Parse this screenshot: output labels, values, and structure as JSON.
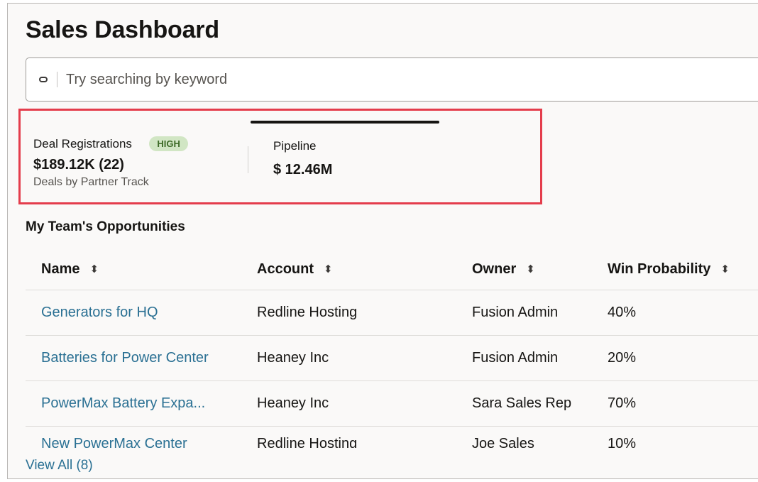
{
  "page": {
    "title": "Sales Dashboard"
  },
  "search": {
    "placeholder": "Try searching by keyword",
    "value": ""
  },
  "metrics": {
    "deal_registrations": {
      "label": "Deal Registrations",
      "badge": "HIGH",
      "value": "$189.12K (22)",
      "subtitle": "Deals by Partner Track"
    },
    "pipeline": {
      "label": "Pipeline",
      "value": "$ 12.46M"
    }
  },
  "opportunities": {
    "title": "My Team's Opportunities",
    "columns": [
      "Name",
      "Account",
      "Owner",
      "Win Probability"
    ],
    "rows": [
      {
        "name": "Generators for HQ",
        "account": "Redline Hosting",
        "owner": "Fusion Admin",
        "win_probability": "40%"
      },
      {
        "name": "Batteries for Power Center",
        "account": "Heaney Inc",
        "owner": "Fusion Admin",
        "win_probability": "20%"
      },
      {
        "name": "PowerMax Battery Expa...",
        "account": "Heaney Inc",
        "owner": "Sara Sales Rep",
        "win_probability": "70%"
      },
      {
        "name": "New PowerMax Center",
        "account": "Redline Hosting",
        "owner": "Joe Sales",
        "win_probability": "10%"
      }
    ],
    "view_all_label": "View All (8)"
  },
  "colors": {
    "accent_link": "#2a7093",
    "highlight_border": "#e43d4c",
    "badge_bg": "#d1e6c4",
    "badge_text": "#3d6b27"
  },
  "icons": {
    "search": "search-icon",
    "sort": "sort-icon"
  }
}
